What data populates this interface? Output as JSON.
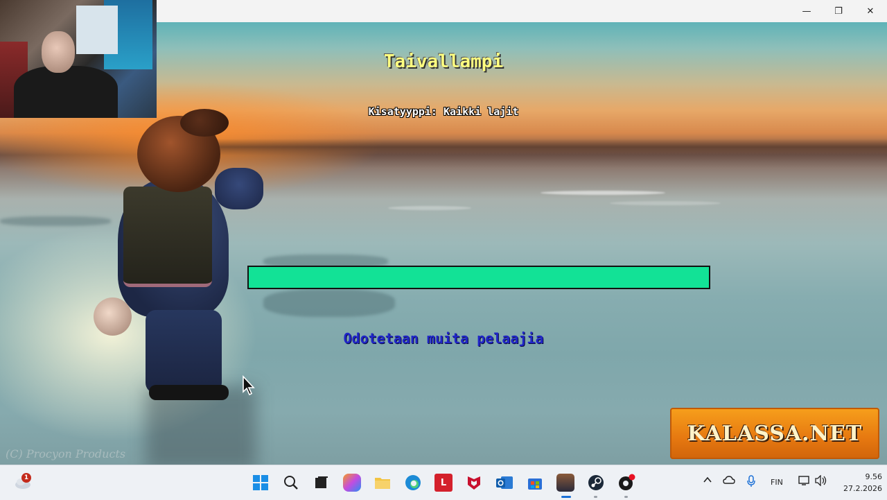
{
  "window": {
    "minimize_glyph": "—",
    "maximize_glyph": "❐",
    "close_glyph": "✕"
  },
  "game": {
    "title": "Taivallampi",
    "competition_type": "Kisatyyppi: Kaikki lajit",
    "progress_fraction": 1.0,
    "progress_color": "#12e296",
    "status_text": "Odotetaan muita pelaajia",
    "copyright": "(C) Procyon Products",
    "logo_text": "KALASSA.NET"
  },
  "taskbar": {
    "notification_count": "1",
    "icons": [
      "start-icon",
      "search-icon",
      "task-view-icon",
      "copilot-icon",
      "file-explorer-icon",
      "edge-icon",
      "l-app-icon",
      "mcafee-icon",
      "outlook-icon",
      "microsoft-store-icon",
      "game-app-icon",
      "steam-icon",
      "media-app-icon"
    ],
    "l_app_label": "L",
    "language": "FIN",
    "time": "9.56",
    "date": "27.2.2026"
  }
}
